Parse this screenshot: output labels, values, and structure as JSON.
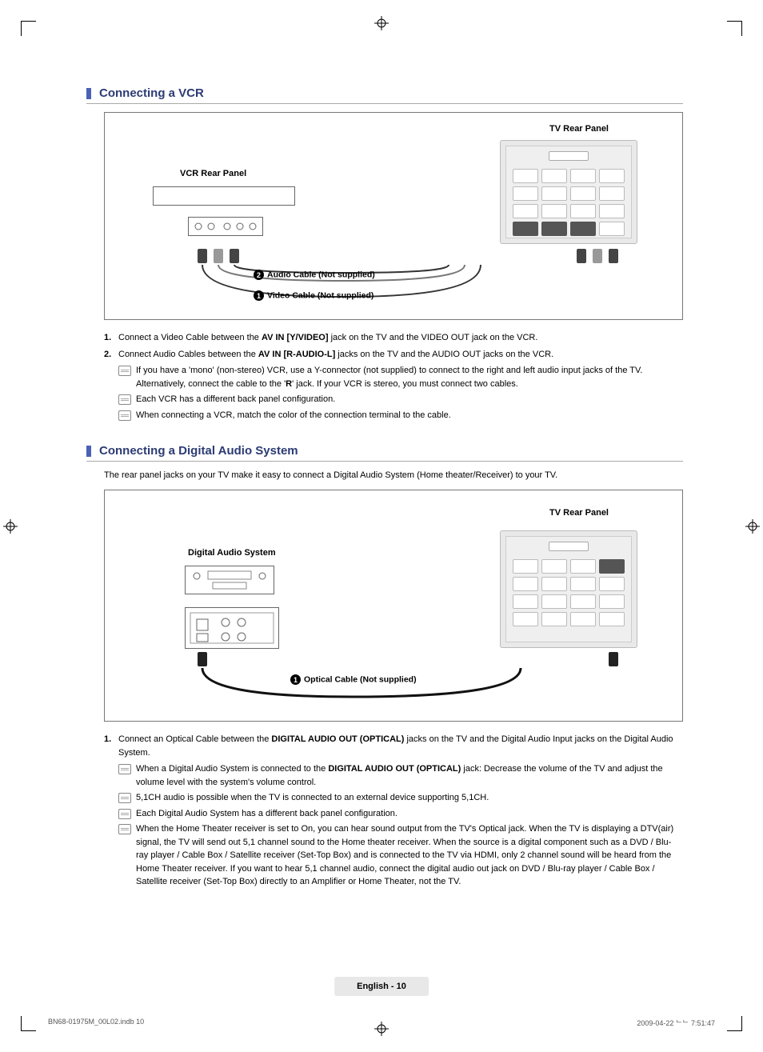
{
  "section1": {
    "title": "Connecting a VCR",
    "labels": {
      "tv_panel": "TV Rear Panel",
      "vcr_panel": "VCR Rear Panel",
      "audio_cable": "Audio Cable (Not supplied)",
      "video_cable": "Video Cable (Not supplied)"
    },
    "steps": {
      "s1_num": "1.",
      "s1_pre": "Connect a Video Cable between the ",
      "s1_bold": "AV IN [Y/VIDEO]",
      "s1_post": " jack on the TV and the VIDEO OUT jack on the VCR.",
      "s2_num": "2.",
      "s2_pre": "Connect Audio Cables between the ",
      "s2_bold": "AV IN [R-AUDIO-L]",
      "s2_post": " jacks on the TV and the AUDIO OUT jacks on the VCR.",
      "n1_pre": "If you have a 'mono' (non-stereo) VCR, use a Y-connector (not supplied) to connect to the right and left audio input jacks of the TV. Alternatively, connect the cable to the '",
      "n1_bold": "R",
      "n1_post": "' jack. If your VCR is stereo, you must connect two cables.",
      "n2": "Each VCR has a different back panel configuration.",
      "n3": "When connecting a VCR, match the color of the connection terminal to the cable."
    }
  },
  "section2": {
    "title": "Connecting a Digital Audio System",
    "intro": "The rear panel jacks on your TV make it easy to connect a Digital Audio System (Home theater/Receiver) to your TV.",
    "labels": {
      "tv_panel": "TV Rear Panel",
      "das_panel": "Digital Audio System",
      "optical_cable": "Optical Cable (Not supplied)"
    },
    "steps": {
      "s1_num": "1.",
      "s1_pre": "Connect an Optical Cable between the ",
      "s1_bold": "DIGITAL AUDIO OUT (OPTICAL)",
      "s1_post": " jacks on the TV and the Digital Audio Input jacks on the Digital Audio System.",
      "n1_pre": "When a Digital Audio System is connected to the ",
      "n1_bold": "DIGITAL AUDIO OUT (OPTICAL)",
      "n1_post": " jack: Decrease the volume of the TV and adjust the volume level with the system's volume control.",
      "n2": "5,1CH audio is possible when the TV is connected to an external device supporting 5,1CH.",
      "n3": "Each Digital Audio System has a different back panel configuration.",
      "n4": "When the Home Theater receiver is set to On, you can hear sound output from the TV's Optical jack. When the TV is displaying a DTV(air) signal, the TV will send out 5,1 channel sound to the Home theater receiver. When the source is a digital component such as a DVD / Blu-ray player / Cable Box / Satellite receiver (Set-Top Box) and is connected to the TV via HDMI, only 2 channel sound will be heard from the Home Theater receiver. If you want to hear 5,1 channel audio, connect the digital audio out jack on DVD / Blu-ray player / Cable Box / Satellite receiver (Set-Top Box) directly to an Amplifier or Home Theater, not the TV."
    }
  },
  "footer": {
    "lang_page": "English - 10",
    "file": "BN68-01975M_00L02.indb   10",
    "timestamp": "2009-04-22   ᄂᄂ 7:51:47"
  }
}
